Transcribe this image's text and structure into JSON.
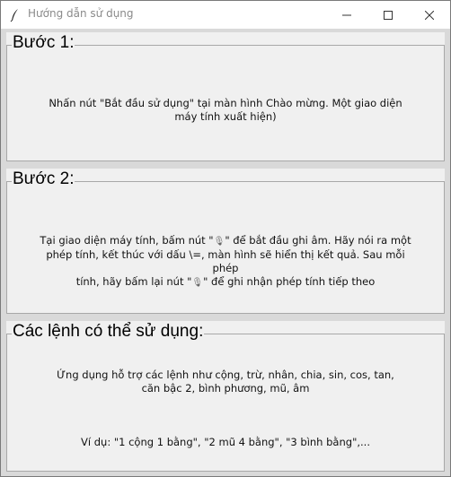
{
  "window": {
    "title": "Hướng dẫn sử dụng"
  },
  "step1": {
    "heading": "Bước 1:",
    "text": "Nhấn nút \"Bắt đầu sử dụng\" tại màn hình Chào mừng. Một giao diện máy tính xuất hiện)"
  },
  "step2": {
    "heading": "Bước 2:",
    "line1_a": "Tại giao diện máy tính, bấm nút \"",
    "line1_b": "\" để bắt đầu ghi âm. Hãy nói ra một",
    "line2": "phép tính, kết thúc với dấu \\=, màn hình sẽ hiển thị kết quả. Sau mỗi phép",
    "line3_a": "tính, hãy bấm lại nút \"",
    "line3_b": "\" để ghi nhận phép tính tiếp theo",
    "mic_glyph": "🎙"
  },
  "commands": {
    "heading": "Các lệnh có thể sử dụng:",
    "text": "Ứng dụng hỗ trợ các lệnh như cộng, trừ, nhân, chia, sin, cos, tan, căn bậc 2, bình phương, mũ, âm",
    "example": "Ví dụ: \"1 cộng 1 bằng\", \"2 mũ 4 bằng\", \"3 bình bằng\",..."
  }
}
